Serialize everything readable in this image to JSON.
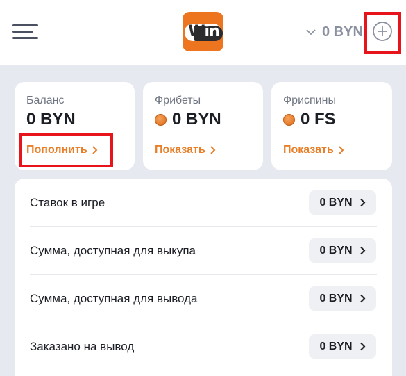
{
  "header": {
    "menu_icon": "hamburger-icon",
    "logo_text_a": "W",
    "logo_text_b": "in",
    "balance": "0 BYN",
    "chevron_icon": "chevron-down-icon",
    "add_icon": "plus-circle-icon"
  },
  "cards": [
    {
      "label": "Баланс",
      "value": "0 BYN",
      "link": "Пополнить",
      "coin": false
    },
    {
      "label": "Фрибеты",
      "value": "0 BYN",
      "link": "Показать",
      "coin": true
    },
    {
      "label": "Фриспины",
      "value": "0 FS",
      "link": "Показать",
      "coin": true
    }
  ],
  "rows": [
    {
      "label": "Ставок в игре",
      "value": "0 BYN"
    },
    {
      "label": "Сумма, доступная для выкупа",
      "value": "0 BYN"
    },
    {
      "label": "Сумма, доступная для вывода",
      "value": "0 BYN"
    },
    {
      "label": "Заказано на вывод",
      "value": "0 BYN"
    }
  ],
  "colors": {
    "accent": "#e8802b",
    "logo": "#ee7520",
    "highlight": "#e8141b",
    "background": "#e6e9ef"
  }
}
